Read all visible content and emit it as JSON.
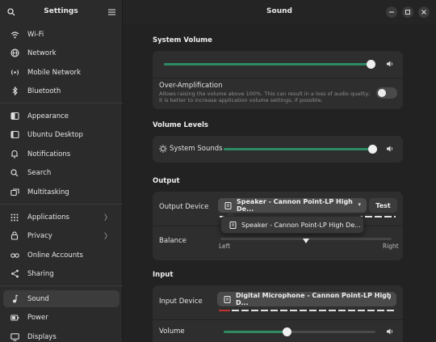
{
  "sidebar": {
    "title": "Settings",
    "items": [
      {
        "label": "Wi-Fi",
        "icon": "wifi-icon"
      },
      {
        "label": "Network",
        "icon": "network-icon"
      },
      {
        "label": "Mobile Network",
        "icon": "mobile-network-icon"
      },
      {
        "label": "Bluetooth",
        "icon": "bluetooth-icon"
      },
      {
        "label": "Appearance",
        "icon": "appearance-icon"
      },
      {
        "label": "Ubuntu Desktop",
        "icon": "ubuntu-desktop-icon"
      },
      {
        "label": "Notifications",
        "icon": "bell-icon"
      },
      {
        "label": "Search",
        "icon": "search-icon"
      },
      {
        "label": "Multitasking",
        "icon": "multitasking-icon"
      },
      {
        "label": "Applications",
        "icon": "grid-icon"
      },
      {
        "label": "Privacy",
        "icon": "lock-icon"
      },
      {
        "label": "Online Accounts",
        "icon": "online-accounts-icon"
      },
      {
        "label": "Sharing",
        "icon": "share-icon"
      },
      {
        "label": "Sound",
        "icon": "music-note-icon"
      },
      {
        "label": "Power",
        "icon": "power-icon"
      },
      {
        "label": "Displays",
        "icon": "display-icon"
      }
    ],
    "active": "Sound"
  },
  "header": {
    "title": "Sound"
  },
  "system_volume": {
    "title": "System Volume",
    "level": 0.98,
    "over_amplification": {
      "label": "Over-Amplification",
      "description": "Allows raising the volume above 100%. This can result in a loss of audio quality; it is better to increase application volume settings, if possible.",
      "enabled": false
    }
  },
  "volume_levels": {
    "title": "Volume Levels",
    "system_sounds_label": "System Sounds",
    "system_sounds_level": 0.98
  },
  "output": {
    "title": "Output",
    "device_label": "Output Device",
    "device_value": "Speaker - Cannon Point-LP High De...",
    "test_label": "Test",
    "popover_option": "Speaker - Cannon Point-LP High De...",
    "balance_label": "Balance",
    "balance_left": "Left",
    "balance_right": "Right",
    "balance_value": 0.5
  },
  "input": {
    "title": "Input",
    "device_label": "Input Device",
    "device_value": "Digital Microphone - Cannon Point-LP High D...",
    "volume_label": "Volume",
    "volume_level": 0.42
  },
  "colors": {
    "accent": "#2e8a63",
    "level_red": "#c23030"
  }
}
